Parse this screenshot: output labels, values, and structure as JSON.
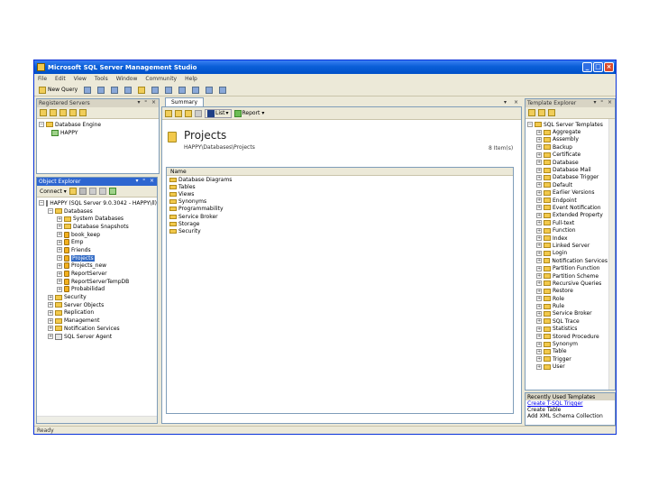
{
  "window": {
    "title": "Microsoft SQL Server Management Studio"
  },
  "menu": [
    "File",
    "Edit",
    "View",
    "Tools",
    "Window",
    "Community",
    "Help"
  ],
  "toolbar": {
    "new_query": "New Query"
  },
  "registered_servers": {
    "title": "Registered Servers",
    "tree": [
      {
        "label": "Database Engine"
      },
      {
        "label": "HAPPY"
      }
    ]
  },
  "object_explorer": {
    "title": "Object Explorer",
    "connect_label": "Connect ▾",
    "tree": [
      {
        "label": "HAPPY (SQL Server 9.0.3042 - HAPPY\\ll)",
        "level": 0,
        "exp": "-",
        "icon": "server"
      },
      {
        "label": "Databases",
        "level": 1,
        "exp": "-",
        "icon": "folder"
      },
      {
        "label": "System Databases",
        "level": 2,
        "exp": "+",
        "icon": "folder"
      },
      {
        "label": "Database Snapshots",
        "level": 2,
        "exp": "+",
        "icon": "folder"
      },
      {
        "label": "book_keep",
        "level": 2,
        "exp": "+",
        "icon": "db"
      },
      {
        "label": "Emp",
        "level": 2,
        "exp": "+",
        "icon": "db"
      },
      {
        "label": "Friends",
        "level": 2,
        "exp": "+",
        "icon": "db"
      },
      {
        "label": "Projects",
        "level": 2,
        "exp": "+",
        "icon": "db",
        "selected": true
      },
      {
        "label": "Projects_new",
        "level": 2,
        "exp": "+",
        "icon": "db"
      },
      {
        "label": "ReportServer",
        "level": 2,
        "exp": "+",
        "icon": "db"
      },
      {
        "label": "ReportServerTempDB",
        "level": 2,
        "exp": "+",
        "icon": "db"
      },
      {
        "label": "Probabilidad",
        "level": 2,
        "exp": "+",
        "icon": "db"
      },
      {
        "label": "Security",
        "level": 1,
        "exp": "+",
        "icon": "folder"
      },
      {
        "label": "Server Objects",
        "level": 1,
        "exp": "+",
        "icon": "folder"
      },
      {
        "label": "Replication",
        "level": 1,
        "exp": "+",
        "icon": "folder"
      },
      {
        "label": "Management",
        "level": 1,
        "exp": "+",
        "icon": "folder"
      },
      {
        "label": "Notification Services",
        "level": 1,
        "exp": "+",
        "icon": "folder"
      },
      {
        "label": "SQL Server Agent",
        "level": 1,
        "exp": "+",
        "icon": "server"
      }
    ]
  },
  "document": {
    "tab": "Summary",
    "title": "Projects",
    "subtitle": "HAPPY\\Databases\\Projects",
    "item_count": "8 Item(s)",
    "report_label": "List",
    "column_header": "Name",
    "items": [
      "Database Diagrams",
      "Tables",
      "Views",
      "Synonyms",
      "Programmability",
      "Service Broker",
      "Storage",
      "Security"
    ]
  },
  "template_explorer": {
    "title": "Template Explorer",
    "tree": [
      {
        "label": "SQL Server Templates",
        "exp": "-",
        "level": 0
      },
      {
        "label": "Aggregate",
        "exp": "+",
        "level": 1
      },
      {
        "label": "Assembly",
        "exp": "+",
        "level": 1
      },
      {
        "label": "Backup",
        "exp": "+",
        "level": 1
      },
      {
        "label": "Certificate",
        "exp": "+",
        "level": 1
      },
      {
        "label": "Database",
        "exp": "+",
        "level": 1
      },
      {
        "label": "Database Mail",
        "exp": "+",
        "level": 1
      },
      {
        "label": "Database Trigger",
        "exp": "+",
        "level": 1
      },
      {
        "label": "Default",
        "exp": "+",
        "level": 1
      },
      {
        "label": "Earlier Versions",
        "exp": "+",
        "level": 1
      },
      {
        "label": "Endpoint",
        "exp": "+",
        "level": 1
      },
      {
        "label": "Event Notification",
        "exp": "+",
        "level": 1
      },
      {
        "label": "Extended Property",
        "exp": "+",
        "level": 1
      },
      {
        "label": "Full-text",
        "exp": "+",
        "level": 1
      },
      {
        "label": "Function",
        "exp": "+",
        "level": 1
      },
      {
        "label": "Index",
        "exp": "+",
        "level": 1
      },
      {
        "label": "Linked Server",
        "exp": "+",
        "level": 1
      },
      {
        "label": "Login",
        "exp": "+",
        "level": 1
      },
      {
        "label": "Notification Services",
        "exp": "+",
        "level": 1
      },
      {
        "label": "Partition Function",
        "exp": "+",
        "level": 1
      },
      {
        "label": "Partition Scheme",
        "exp": "+",
        "level": 1
      },
      {
        "label": "Recursive Queries",
        "exp": "+",
        "level": 1
      },
      {
        "label": "Restore",
        "exp": "+",
        "level": 1
      },
      {
        "label": "Role",
        "exp": "+",
        "level": 1
      },
      {
        "label": "Rule",
        "exp": "+",
        "level": 1
      },
      {
        "label": "Service Broker",
        "exp": "+",
        "level": 1
      },
      {
        "label": "SQL Trace",
        "exp": "+",
        "level": 1
      },
      {
        "label": "Statistics",
        "exp": "+",
        "level": 1
      },
      {
        "label": "Stored Procedure",
        "exp": "+",
        "level": 1
      },
      {
        "label": "Synonym",
        "exp": "+",
        "level": 1
      },
      {
        "label": "Table",
        "exp": "+",
        "level": 1
      },
      {
        "label": "Trigger",
        "exp": "+",
        "level": 1
      },
      {
        "label": "User",
        "exp": "+",
        "level": 1
      }
    ]
  },
  "recent_templates": {
    "title": "Recently Used Templates",
    "links": [
      "Create T-SQL Trigger",
      "Create Table",
      "Add XML Schema Collection"
    ]
  },
  "status": {
    "text": "Ready"
  }
}
